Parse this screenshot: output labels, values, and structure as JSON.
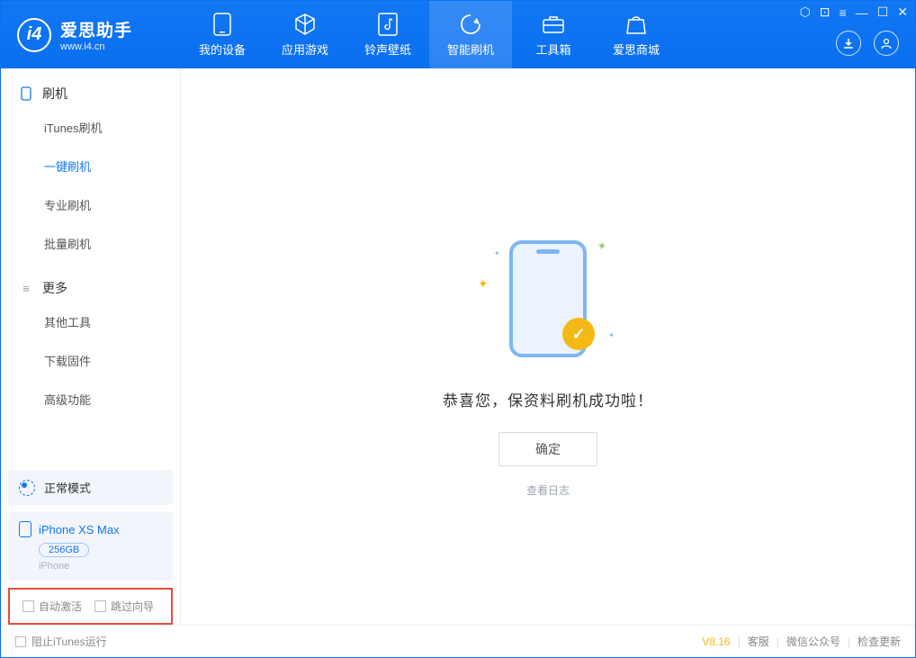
{
  "app": {
    "title": "爱思助手",
    "subtitle": "www.i4.cn"
  },
  "nav": {
    "items": [
      {
        "label": "我的设备"
      },
      {
        "label": "应用游戏"
      },
      {
        "label": "铃声壁纸"
      },
      {
        "label": "智能刷机"
      },
      {
        "label": "工具箱"
      },
      {
        "label": "爱思商城"
      }
    ]
  },
  "sidebar": {
    "section1": {
      "title": "刷机",
      "items": [
        "iTunes刷机",
        "一键刷机",
        "专业刷机",
        "批量刷机"
      ]
    },
    "section2": {
      "title": "更多",
      "items": [
        "其他工具",
        "下载固件",
        "高级功能"
      ]
    },
    "mode_label": "正常模式",
    "device": {
      "name": "iPhone XS Max",
      "capacity": "256GB",
      "type": "iPhone"
    },
    "checks": {
      "auto_activate": "自动激活",
      "skip_guide": "跳过向导"
    }
  },
  "main": {
    "success": "恭喜您，保资料刷机成功啦！",
    "ok": "确定",
    "view_log": "查看日志"
  },
  "footer": {
    "block_itunes": "阻止iTunes运行",
    "version": "V8.16",
    "service": "客服",
    "wechat": "微信公众号",
    "update": "检查更新"
  }
}
